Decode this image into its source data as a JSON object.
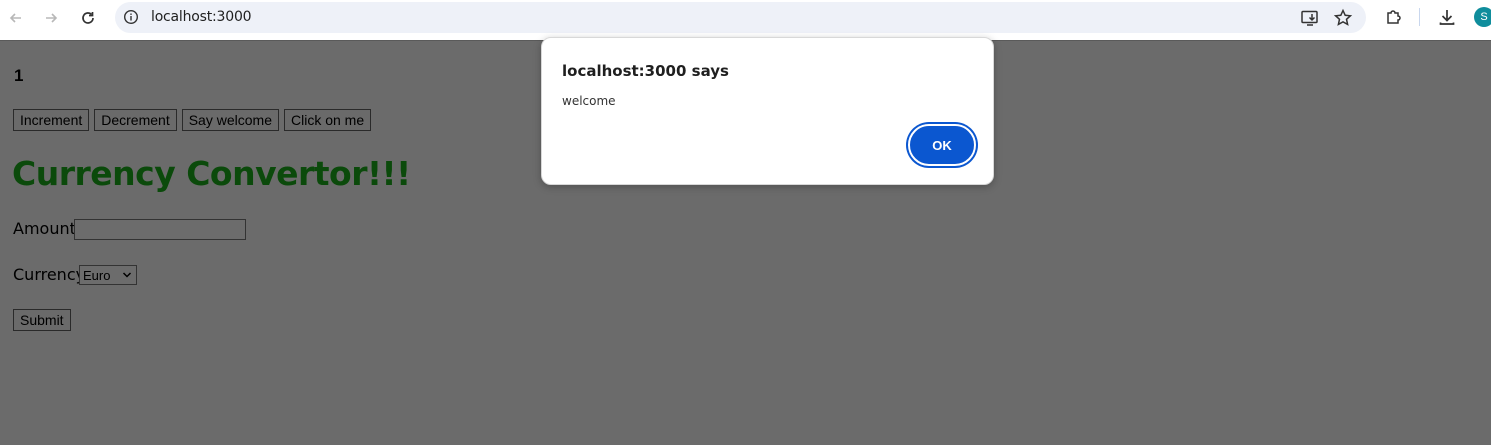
{
  "browser": {
    "url": "localhost:3000",
    "icons": {
      "back": "arrow-left-icon",
      "forward": "arrow-right-icon",
      "reload": "reload-icon",
      "site_info": "info-icon",
      "install": "install-app-icon",
      "bookmark": "star-icon",
      "extensions": "puzzle-icon",
      "downloads": "download-icon"
    },
    "avatar_initial": "S",
    "avatar_color": "#0f8d9c"
  },
  "page": {
    "counter": "1",
    "buttons": [
      "Increment",
      "Decrement",
      "Say welcome",
      "Click on me"
    ],
    "title": "Currency Convertor!!!",
    "title_color": "#0b4a0b",
    "form": {
      "amount_label": "Amount:",
      "amount_value": "",
      "currency_label": "Currency:",
      "currency_selected": "Euro",
      "submit_label": "Submit"
    }
  },
  "dialog": {
    "title": "localhost:3000 says",
    "message": "welcome",
    "ok_label": "OK",
    "ok_color": "#0b57d0"
  }
}
